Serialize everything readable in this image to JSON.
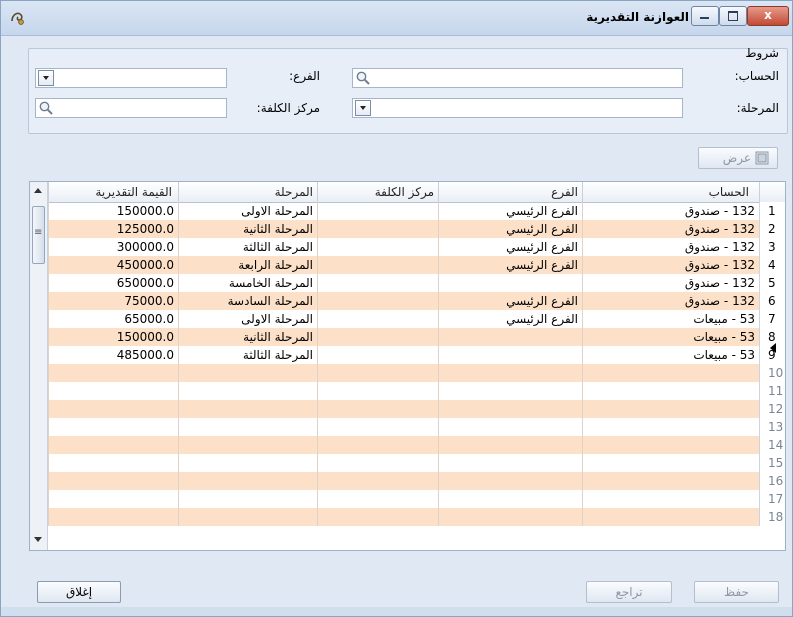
{
  "window": {
    "title": "العوازنة التقديرية",
    "close_glyph": "x",
    "app_icon": "app-logo-icon"
  },
  "conditions": {
    "group_label": "شروط",
    "account_label": "الحساب:",
    "account_value": "",
    "branch_label": "الفرع:",
    "branch_value": "",
    "stage_label": "المرحلة:",
    "stage_value": "",
    "costcenter_label": "مركز الكلفة:",
    "costcenter_value": ""
  },
  "view_button": "عرض",
  "grid": {
    "columns": {
      "account": "الحساب",
      "branch": "الفرع",
      "costcenter": "مركز الكلفة",
      "stage": "المرحلة",
      "value": "القيمة التقديرية"
    },
    "rows": [
      {
        "n": "1",
        "account": "132 - صندوق",
        "branch": "الفرع الرئيسي",
        "costcenter": "",
        "stage": "المرحلة الاولى",
        "value": "150000.0"
      },
      {
        "n": "2",
        "account": "132 - صندوق",
        "branch": "الفرع الرئيسي",
        "costcenter": "",
        "stage": "المرحلة الثانية",
        "value": "125000.0"
      },
      {
        "n": "3",
        "account": "132 - صندوق",
        "branch": "الفرع الرئيسي",
        "costcenter": "",
        "stage": "المرحلة الثالثة",
        "value": "300000.0"
      },
      {
        "n": "4",
        "account": "132 - صندوق",
        "branch": "الفرع الرئيسي",
        "costcenter": "",
        "stage": "المرحلة الرابعة",
        "value": "450000.0"
      },
      {
        "n": "5",
        "account": "132 - صندوق",
        "branch": "",
        "costcenter": "",
        "stage": "المرحلة الخامسة",
        "value": "650000.0"
      },
      {
        "n": "6",
        "account": "132 - صندوق",
        "branch": "الفرع الرئيسي",
        "costcenter": "",
        "stage": "المرحلة السادسة",
        "value": "75000.0"
      },
      {
        "n": "7",
        "account": "53 - مبيعات",
        "branch": "الفرع الرئيسي",
        "costcenter": "",
        "stage": "المرحلة الاولى",
        "value": "65000.0"
      },
      {
        "n": "8",
        "account": "53 - مبيعات",
        "branch": "",
        "costcenter": "",
        "stage": "المرحلة الثانية",
        "value": "150000.0"
      },
      {
        "n": "9",
        "account": "53 - مبيعات",
        "branch": "",
        "costcenter": "",
        "stage": "المرحلة الثالثة",
        "value": "485000.0"
      }
    ],
    "empty_rows": [
      "10",
      "11",
      "12",
      "13",
      "14",
      "15",
      "16",
      "17",
      "18"
    ]
  },
  "footer": {
    "save": "حفظ",
    "undo": "تراجع",
    "close": "إغلاق"
  }
}
